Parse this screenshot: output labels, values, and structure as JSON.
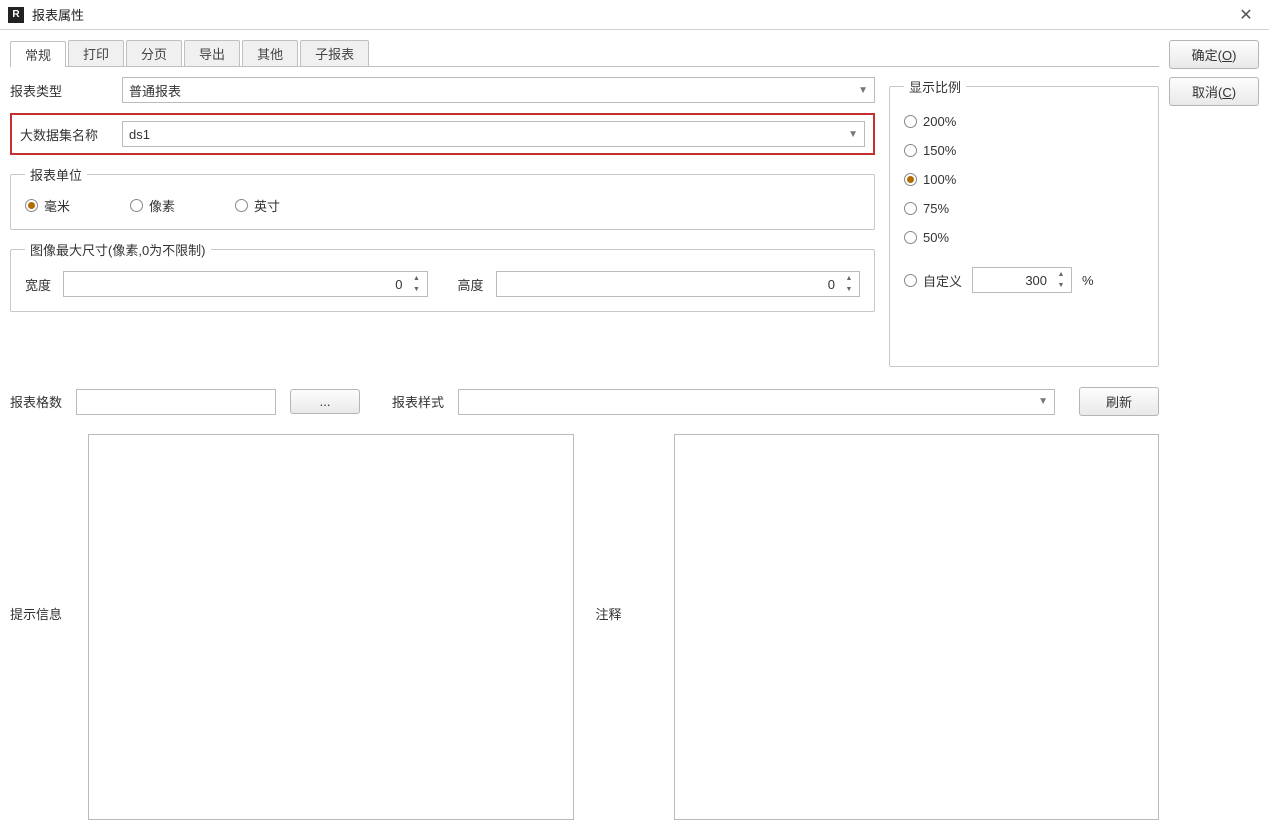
{
  "window": {
    "title": "报表属性"
  },
  "buttons": {
    "ok": "确定",
    "ok_hotkey": "O",
    "cancel": "取消",
    "cancel_hotkey": "C",
    "browse": "...",
    "refresh": "刷新"
  },
  "tabs": [
    "常规",
    "打印",
    "分页",
    "导出",
    "其他",
    "子报表"
  ],
  "active_tab": 0,
  "fields": {
    "report_type_label": "报表类型",
    "report_type_value": "普通报表",
    "dataset_label": "大数据集名称",
    "dataset_value": "ds1",
    "unit_legend": "报表单位",
    "unit_options": [
      "毫米",
      "像素",
      "英寸"
    ],
    "unit_selected": 0,
    "maxsize_legend": "图像最大尺寸(像素,0为不限制)",
    "width_label": "宽度",
    "width_value": "0",
    "height_label": "高度",
    "height_value": "0",
    "ratio_legend": "显示比例",
    "ratio_options": [
      "200%",
      "150%",
      "100%",
      "75%",
      "50%"
    ],
    "ratio_selected": 2,
    "ratio_custom_label": "自定义",
    "ratio_custom_value": "300",
    "ratio_custom_unit": "%",
    "format_label": "报表格数",
    "format_value": "",
    "style_label": "报表样式",
    "style_value": "",
    "hint_label": "提示信息",
    "comment_label": "注释"
  }
}
